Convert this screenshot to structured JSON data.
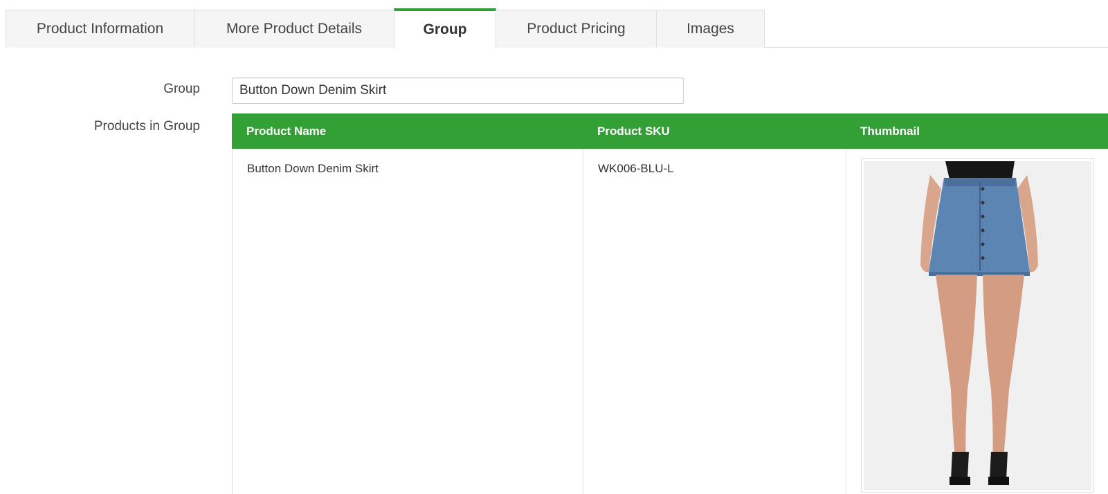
{
  "tabs": [
    {
      "label": "Product Information",
      "active": false
    },
    {
      "label": "More Product Details",
      "active": false
    },
    {
      "label": "Group",
      "active": true
    },
    {
      "label": "Product Pricing",
      "active": false
    },
    {
      "label": "Images",
      "active": false
    }
  ],
  "form": {
    "group_label": "Group",
    "group_value": "Button Down Denim Skirt",
    "products_label": "Products in Group"
  },
  "table": {
    "headers": [
      "Product Name",
      "Product SKU",
      "Thumbnail"
    ],
    "rows": [
      {
        "name": "Button Down Denim Skirt",
        "sku": "WK006-BLU-L"
      }
    ]
  },
  "colors": {
    "accent": "#33a036",
    "tab_bg": "#f5f5f5",
    "border": "#dddddd"
  }
}
